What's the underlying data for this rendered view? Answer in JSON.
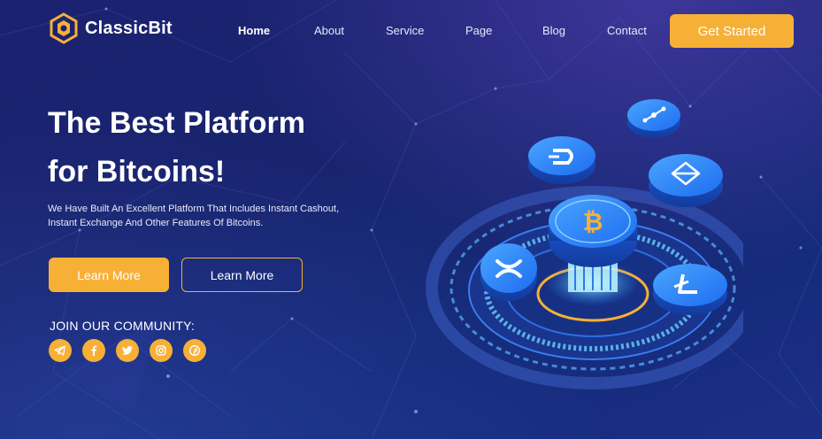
{
  "brand": {
    "name": "ClassicBit",
    "accent": "#f7b036",
    "background": "#18246e"
  },
  "nav": {
    "home": "Home",
    "about": "About",
    "service": "Service",
    "page": "Page",
    "blog": "Blog",
    "contact": "Contact"
  },
  "header": {
    "cta": "Get Started"
  },
  "hero": {
    "title_line1": "The Best Platform",
    "title_line2": "for Bitcoins!",
    "description_line1": "We Have Built An Excellent Platform That Includes Instant Cashout,",
    "description_line2": "Instant Exchange And Other Features Of Bitcoins.",
    "primary_button": "Learn More",
    "secondary_button": "Learn More"
  },
  "community": {
    "title": "JOIN OUR COMMUNITY:",
    "icons": [
      "telegram-icon",
      "facebook-icon",
      "twitter-icon",
      "instagram-icon",
      "pinterest-icon"
    ]
  },
  "illustration": {
    "coins": [
      "bitcoin-icon",
      "ethereum-icon",
      "litecoin-icon",
      "ripple-icon",
      "dash-icon",
      "network-icon"
    ]
  }
}
